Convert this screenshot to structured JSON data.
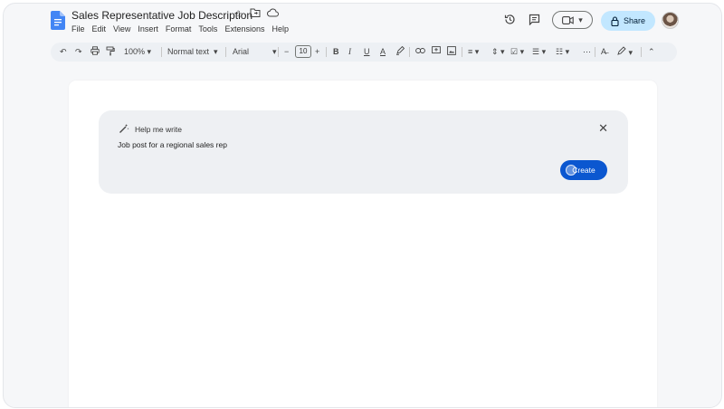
{
  "doc": {
    "title": "Sales Representative Job Description"
  },
  "title_icons": [
    "star-icon",
    "folder-move-icon",
    "cloud-status-icon"
  ],
  "menu": [
    "File",
    "Edit",
    "View",
    "Insert",
    "Format",
    "Tools",
    "Extensions",
    "Help"
  ],
  "header_right": {
    "history_icon": "history-icon",
    "comments_icon": "comment-icon",
    "meet_icon": "videocam-icon",
    "share_label": "Share",
    "share_icon": "lock-icon"
  },
  "toolbar": {
    "zoom": "100%",
    "style": "Normal text",
    "font": "Arial",
    "font_size": "10"
  },
  "help_me_write": {
    "label": "Help me write",
    "prompt": "Job post for a regional sales rep",
    "create_label": "Create"
  },
  "colors": {
    "accent": "#0b57d0",
    "share_bg": "#c2e7ff",
    "docs_blue": "#4285f4"
  }
}
